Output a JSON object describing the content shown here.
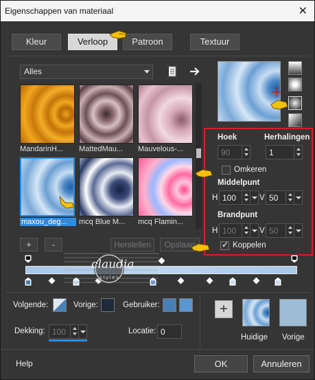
{
  "window": {
    "title": "Eigenschappen van materiaal",
    "close": "✕"
  },
  "tabs": [
    {
      "label": "Kleur"
    },
    {
      "label": "Verloop"
    },
    {
      "label": "Patroon"
    },
    {
      "label": "Textuur"
    }
  ],
  "library": {
    "category": "Alles",
    "items": [
      {
        "label": "MandarinH..."
      },
      {
        "label": "MattedMau..."
      },
      {
        "label": "Mauvelous-..."
      },
      {
        "label": "maxou_deg..."
      },
      {
        "label": "mcq Blue M..."
      },
      {
        "label": "mcq Flamin..."
      }
    ],
    "add": "+",
    "remove": "-",
    "restore": "Herstellen",
    "save": "Opslaan"
  },
  "settings": {
    "angle_label": "Hoek",
    "angle_value": "90",
    "repeats_label": "Herhalingen",
    "repeats_value": "1",
    "reverse_label": "Omkeren",
    "reverse_checked": false,
    "center_label": "Middelpunt",
    "center_h_label": "H",
    "center_h_value": "100",
    "center_v_label": "V",
    "center_v_value": "50",
    "focal_label": "Brandpunt",
    "focal_h_label": "H",
    "focal_h_value": "100",
    "focal_v_label": "V",
    "focal_v_value": "50",
    "link_label": "Koppelen",
    "link_checked": true
  },
  "watermark": {
    "text": "claudia",
    "subtext": "s t y l e s"
  },
  "bottom": {
    "foreground_label": "Volgende:",
    "previous_label": "Vorige:",
    "user_label": "Gebruiker:",
    "opacity_label": "Dekking:",
    "opacity_value": "100",
    "location_label": "Locatie:",
    "location_value": "0",
    "current_label": "Huidige",
    "previous_preview_label": "Vorige",
    "add": "+"
  },
  "footer": {
    "help": "Help",
    "ok": "OK",
    "cancel": "Annuleren"
  },
  "colors": {
    "accent": "#2f8be0",
    "highlight_box": "#d81f1f",
    "user_color_1": "#4a7fb5",
    "user_color_2": "#5a96d0",
    "previous_color": "#9dbcd6"
  },
  "icons": [
    "close-icon",
    "page-icon",
    "arrow-right-icon",
    "pointing-hand-icon",
    "gradient-style-linear-icon",
    "gradient-style-rectangular-icon",
    "gradient-style-sunburst-icon",
    "gradient-style-radial-icon"
  ]
}
